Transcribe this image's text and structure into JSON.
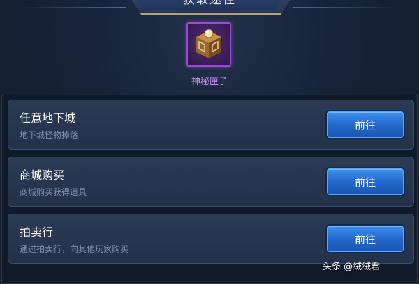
{
  "header": {
    "title": "获取途径"
  },
  "item": {
    "name": "神秘匣子",
    "icon": "mystery-box-icon"
  },
  "sources": [
    {
      "title": "任意地下城",
      "description": "地下城怪物掉落",
      "button": "前往"
    },
    {
      "title": "商城购买",
      "description": "商城购买获得道具",
      "button": "前往"
    },
    {
      "title": "拍卖行",
      "description": "通过拍卖行，向其他玩家购买",
      "button": "前往"
    }
  ],
  "watermark": {
    "text": "头条 @绒绒君"
  },
  "colors": {
    "accent_purple": "#c98cf0",
    "button_blue": "#2369cc",
    "banner_gold": "#b9a06a"
  }
}
